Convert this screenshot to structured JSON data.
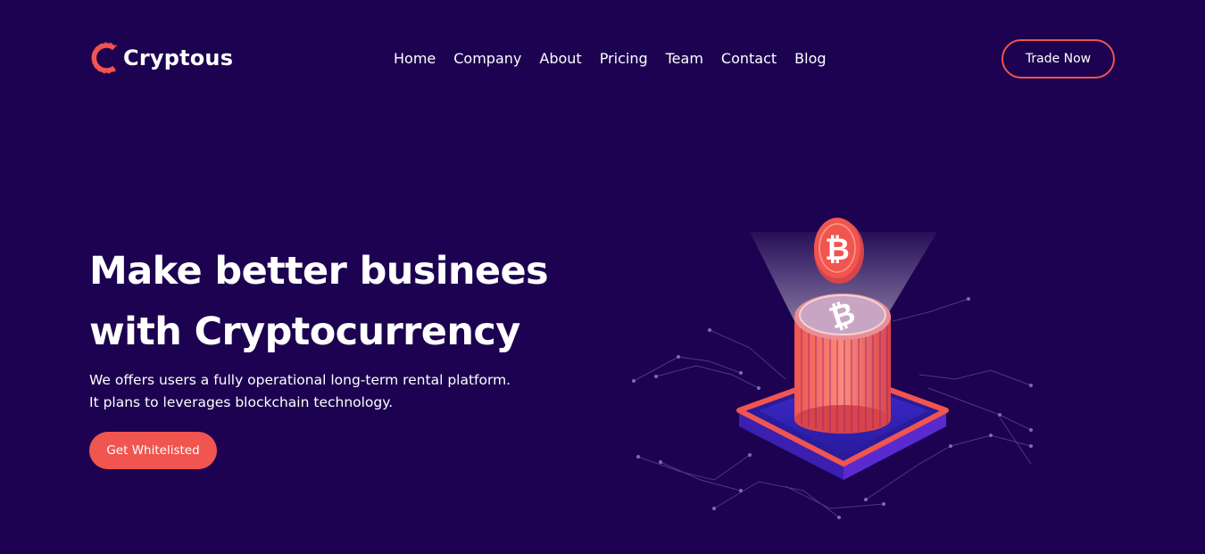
{
  "brand": {
    "name": "Cryptous",
    "accent_color": "#f0554f",
    "background_color": "#1c0250"
  },
  "nav": {
    "items": [
      {
        "label": "Home"
      },
      {
        "label": "Company"
      },
      {
        "label": "About"
      },
      {
        "label": "Pricing"
      },
      {
        "label": "Team"
      },
      {
        "label": "Contact"
      },
      {
        "label": "Blog"
      }
    ]
  },
  "header": {
    "cta_label": "Trade Now"
  },
  "hero": {
    "title_line1": "Make better businees",
    "title_line2": "with Cryptocurrency",
    "desc_line1": "We offers users a fully operational long-term rental platform.",
    "desc_line2": "It plans to leverages blockchain technology.",
    "cta_label": "Get Whitelisted"
  },
  "illustration": {
    "icons": [
      "bitcoin-coin-icon",
      "coin-stack-icon",
      "circuit-lines"
    ]
  }
}
